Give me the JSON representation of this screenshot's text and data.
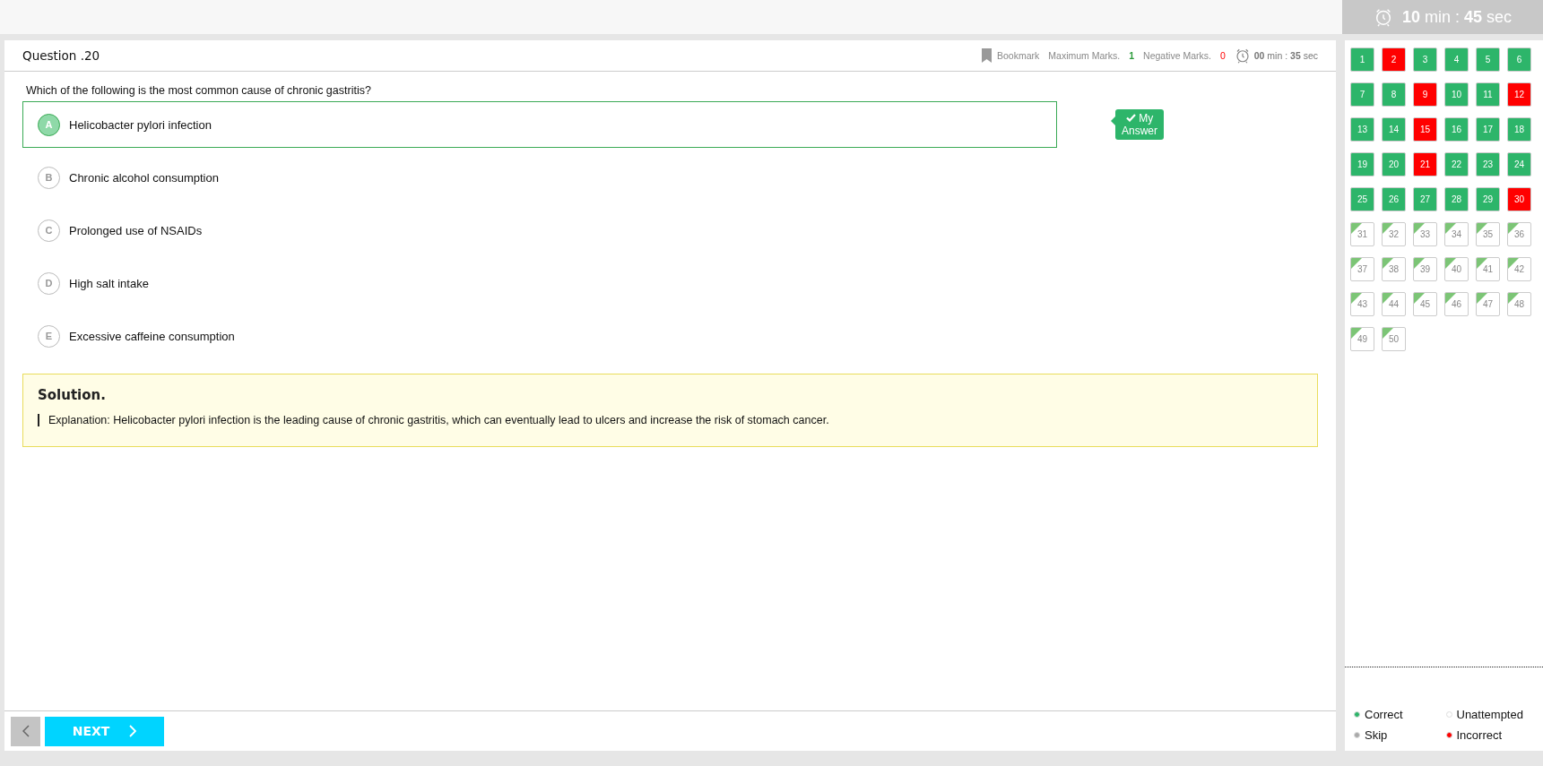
{
  "exam_timer": "**10** min : **45** sec",
  "question": {
    "title": "Question .20",
    "bookmark": "Bookmark",
    "max_marks_label": "Maximum Marks.",
    "max_marks": "1",
    "negative_marks_label": "Negative Marks.",
    "negative_marks": "0",
    "timer": "**00** min : **35** sec",
    "text": "Which of the following is the most common cause of chronic gastritis?",
    "options": [
      {
        "letter": "A",
        "text": "Helicobacter pylori infection",
        "selected": true
      },
      {
        "letter": "B",
        "text": "Chronic alcohol consumption",
        "selected": false
      },
      {
        "letter": "C",
        "text": "Prolonged use of NSAIDs",
        "selected": false
      },
      {
        "letter": "D",
        "text": "High salt intake",
        "selected": false
      },
      {
        "letter": "E",
        "text": "Excessive caffeine consumption",
        "selected": false
      }
    ],
    "my_answer_tag": "My Answer"
  },
  "solution": {
    "title": "Solution.",
    "text": "Explanation: Helicobacter pylori infection is the leading cause of chronic gastritis, which can eventually lead to ulcers and increase the risk of stomach cancer."
  },
  "nav": {
    "next": "NEXT"
  },
  "palette": [
    {
      "label": "1",
      "kind": "correct"
    },
    {
      "label": "2",
      "kind": "incorrect"
    },
    {
      "label": "3",
      "kind": "correct"
    },
    {
      "label": "4",
      "kind": "correct"
    },
    {
      "label": "5",
      "kind": "correct"
    },
    {
      "label": "6",
      "kind": "correct"
    },
    {
      "label": "7",
      "kind": "correct"
    },
    {
      "label": "8",
      "kind": "correct"
    },
    {
      "label": "9",
      "kind": "incorrect"
    },
    {
      "label": "10",
      "kind": "correct"
    },
    {
      "label": "11",
      "kind": "correct"
    },
    {
      "label": "12",
      "kind": "incorrect"
    },
    {
      "label": "13",
      "kind": "correct"
    },
    {
      "label": "14",
      "kind": "correct"
    },
    {
      "label": "15",
      "kind": "incorrect"
    },
    {
      "label": "16",
      "kind": "correct"
    },
    {
      "label": "17",
      "kind": "correct"
    },
    {
      "label": "18",
      "kind": "correct"
    },
    {
      "label": "19",
      "kind": "correct"
    },
    {
      "label": "20",
      "kind": "correct"
    },
    {
      "label": "21",
      "kind": "incorrect"
    },
    {
      "label": "22",
      "kind": "correct"
    },
    {
      "label": "23",
      "kind": "correct"
    },
    {
      "label": "24",
      "kind": "correct"
    },
    {
      "label": "25",
      "kind": "correct"
    },
    {
      "label": "26",
      "kind": "correct"
    },
    {
      "label": "27",
      "kind": "correct"
    },
    {
      "label": "28",
      "kind": "correct"
    },
    {
      "label": "29",
      "kind": "correct"
    },
    {
      "label": "30",
      "kind": "incorrect"
    },
    {
      "label": "31",
      "kind": "unattempted"
    },
    {
      "label": "32",
      "kind": "unattempted"
    },
    {
      "label": "33",
      "kind": "unattempted"
    },
    {
      "label": "34",
      "kind": "unattempted"
    },
    {
      "label": "35",
      "kind": "unattempted"
    },
    {
      "label": "36",
      "kind": "unattempted"
    },
    {
      "label": "37",
      "kind": "unattempted"
    },
    {
      "label": "38",
      "kind": "unattempted"
    },
    {
      "label": "39",
      "kind": "unattempted"
    },
    {
      "label": "40",
      "kind": "unattempted"
    },
    {
      "label": "41",
      "kind": "unattempted"
    },
    {
      "label": "42",
      "kind": "unattempted"
    },
    {
      "label": "43",
      "kind": "unattempted"
    },
    {
      "label": "44",
      "kind": "unattempted"
    },
    {
      "label": "45",
      "kind": "unattempted"
    },
    {
      "label": "46",
      "kind": "unattempted"
    },
    {
      "label": "47",
      "kind": "unattempted"
    },
    {
      "label": "48",
      "kind": "unattempted"
    },
    {
      "label": "49",
      "kind": "unattempted"
    },
    {
      "label": "50",
      "kind": "unattempted"
    }
  ],
  "legend": [
    {
      "label": "Correct",
      "color": "#2db56a"
    },
    {
      "label": "Unattempted",
      "color": "#ffffff"
    },
    {
      "label": "Skip",
      "color": "#aaaaaa"
    },
    {
      "label": "Incorrect",
      "color": "#ff0000"
    }
  ]
}
